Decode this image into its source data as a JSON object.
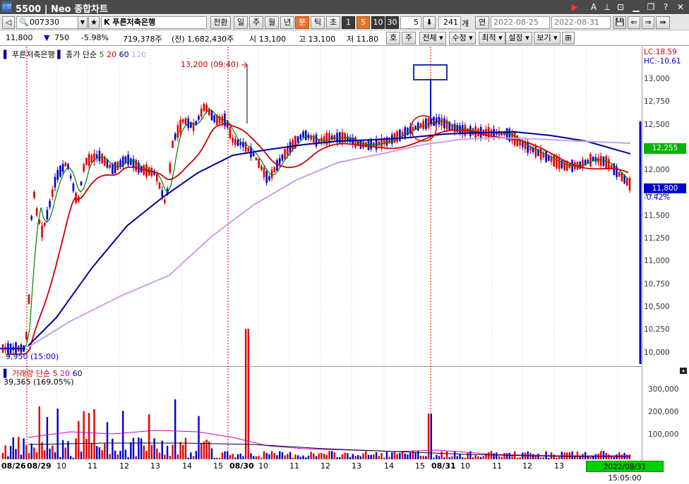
{
  "window": {
    "app_badge": "신한",
    "title": "5500 | Neo 종합차트"
  },
  "toolbar1": {
    "code": "007330",
    "name": "K 푸른저축은행",
    "switch_label": "전환",
    "periods": [
      "일",
      "주",
      "월",
      "년",
      "분",
      "틱",
      "초"
    ],
    "active_period": "분",
    "intervals": [
      "1",
      "5",
      "10",
      "30"
    ],
    "active_interval": "5",
    "interval_input": "5",
    "count": "241",
    "count_unit": "개",
    "yeon_label": "연",
    "date_from": "2022-08-25",
    "date_to": "2022-08-31"
  },
  "toolbar2": {
    "price": "11,800",
    "change_arrow": "▼",
    "change": "750",
    "change_pct": "-5.98%",
    "volume": "719,378주",
    "prev_volume": "(전) 1,682,430주",
    "open": "시 13,100",
    "high": "고 13,100",
    "low": "저 11,80",
    "ho_label": "호",
    "ju_label": "주",
    "menu": [
      "전체",
      "수정",
      "최적",
      "설정",
      "보기"
    ]
  },
  "colors": {
    "up": "#e00000",
    "down": "#0000cc",
    "ma5": "#008000",
    "ma20": "#cc0000",
    "ma60": "#000099",
    "ma120": "#c9a0e8"
  },
  "price_chart": {
    "legend": {
      "name": "푸른저축은행",
      "ma_label": "종가 단순",
      "ma5": "5",
      "ma20": "20",
      "ma60": "60",
      "ma120": "120"
    },
    "lc": "LC:18.59",
    "hc": "HC:-10.61",
    "y_ticks": [
      "13,000",
      "12,750",
      "12,500",
      "12,250",
      "12,000",
      "11,750",
      "11,500",
      "11,250",
      "11,000",
      "10,750",
      "10,500",
      "10,250",
      "10,000"
    ],
    "ma_tag": "12,255",
    "cur_price_tag": "11,800",
    "cur_pct": "-0.42%",
    "high_note": "13,200 (09:40)",
    "low_note": "9,950 (15:00)"
  },
  "volume_chart": {
    "legend": {
      "name": "거래량",
      "ma_label": "단순",
      "ma5": "5",
      "ma20": "20",
      "ma60": "60"
    },
    "last": "39,365 (169,05%)",
    "y_ticks": [
      "300,000",
      "200,000",
      "100,000"
    ]
  },
  "x_axis": {
    "labels": [
      "08/26",
      "08/29",
      "10",
      "11",
      "12",
      "13",
      "14",
      "15",
      "08/30",
      "10",
      "11",
      "12",
      "13",
      "14",
      "15",
      "08/31",
      "10",
      "11",
      "12",
      "13"
    ],
    "bold": [
      "08/26",
      "08/29",
      "08/30",
      "08/31"
    ],
    "time_tag": "2022/08/31 15:05:00"
  }
}
